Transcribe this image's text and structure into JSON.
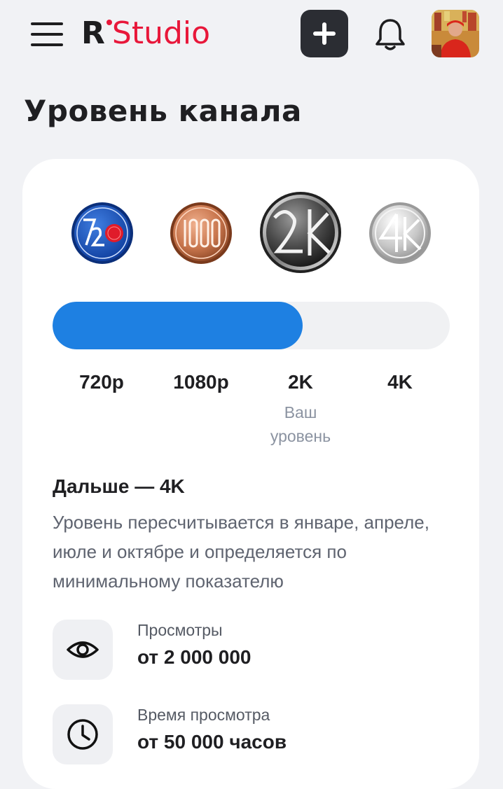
{
  "header": {
    "logo_r": "R",
    "logo_studio": "Studio",
    "menu_icon": "menu-icon",
    "add_icon": "plus-icon",
    "bell_icon": "bell-icon",
    "accent_color": "#e8173a"
  },
  "page": {
    "title": "Уровень канала"
  },
  "levels": {
    "progress_fraction": 0.63,
    "progress_color": "#1e80e2",
    "items": [
      {
        "label": "720p",
        "badge": "720-badge-icon"
      },
      {
        "label": "1080p",
        "badge": "1080-badge-icon"
      },
      {
        "label": "2K",
        "badge": "2k-badge-icon",
        "current_note": "Ваш уровень"
      },
      {
        "label": "4K",
        "badge": "4k-badge-icon"
      }
    ]
  },
  "next": {
    "title": "Дальше — 4K",
    "description": "Уровень пересчитывается в январе, апреле, июле и октябре и определяется по минимальному показателю"
  },
  "requirements": [
    {
      "icon": "eye-icon",
      "label": "Просмотры",
      "value": "от 2 000 000"
    },
    {
      "icon": "clock-icon",
      "label": "Время просмотра",
      "value": "от 50 000 часов"
    }
  ]
}
